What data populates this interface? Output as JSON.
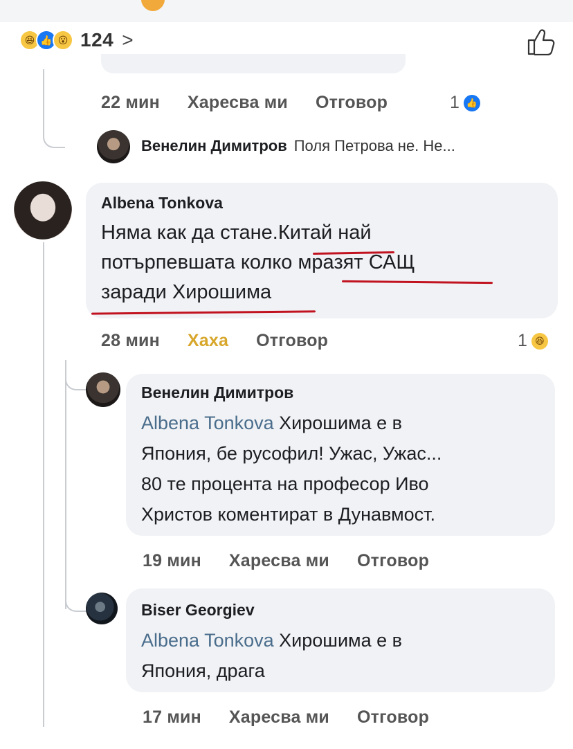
{
  "reactions": {
    "count": "124",
    "icons": [
      "haha-icon",
      "like-icon",
      "wow-icon"
    ]
  },
  "comment_prev": {
    "time": "22 мин",
    "like": "Харесва ми",
    "reply": "Отговор",
    "reaction_count": "1"
  },
  "reply_preview": {
    "name": "Венелин Димитров",
    "text": "Поля Петрова не. Не..."
  },
  "comment_albena": {
    "author": "Albena Tonkova",
    "text_lines": [
      "Няма как да стане.Китай най",
      "потърпевшата колко мразят САЩ",
      "заради Хирошима"
    ],
    "time": "28 мин",
    "reaction_label": "Хаха",
    "reply": "Отговор",
    "reaction_count": "1"
  },
  "reply_venelin": {
    "author": "Венелин Димитров",
    "mention": "Albena Tonkova",
    "text_first": " Хирошима е в",
    "text_lines": [
      "Япония, бе русофил!  Ужас, Ужас...",
      "80 те процента на професор Иво",
      "Христов коментират в Дунавмост."
    ],
    "time": "19 мин",
    "like": "Харесва ми",
    "reply": "Отговор"
  },
  "reply_biser": {
    "author": "Biser Georgiev",
    "mention": "Albena Tonkova",
    "text_first": " Хирошима е в",
    "text_lines": [
      "Япония, драга"
    ],
    "time": "17 мин",
    "like": "Харесва ми",
    "reply": "Отговор"
  },
  "colors": {
    "haha_label": "#d7a62a",
    "mention": "#4a6d8c",
    "underline": "#c1121f",
    "bubble": "#f0f2f5"
  }
}
